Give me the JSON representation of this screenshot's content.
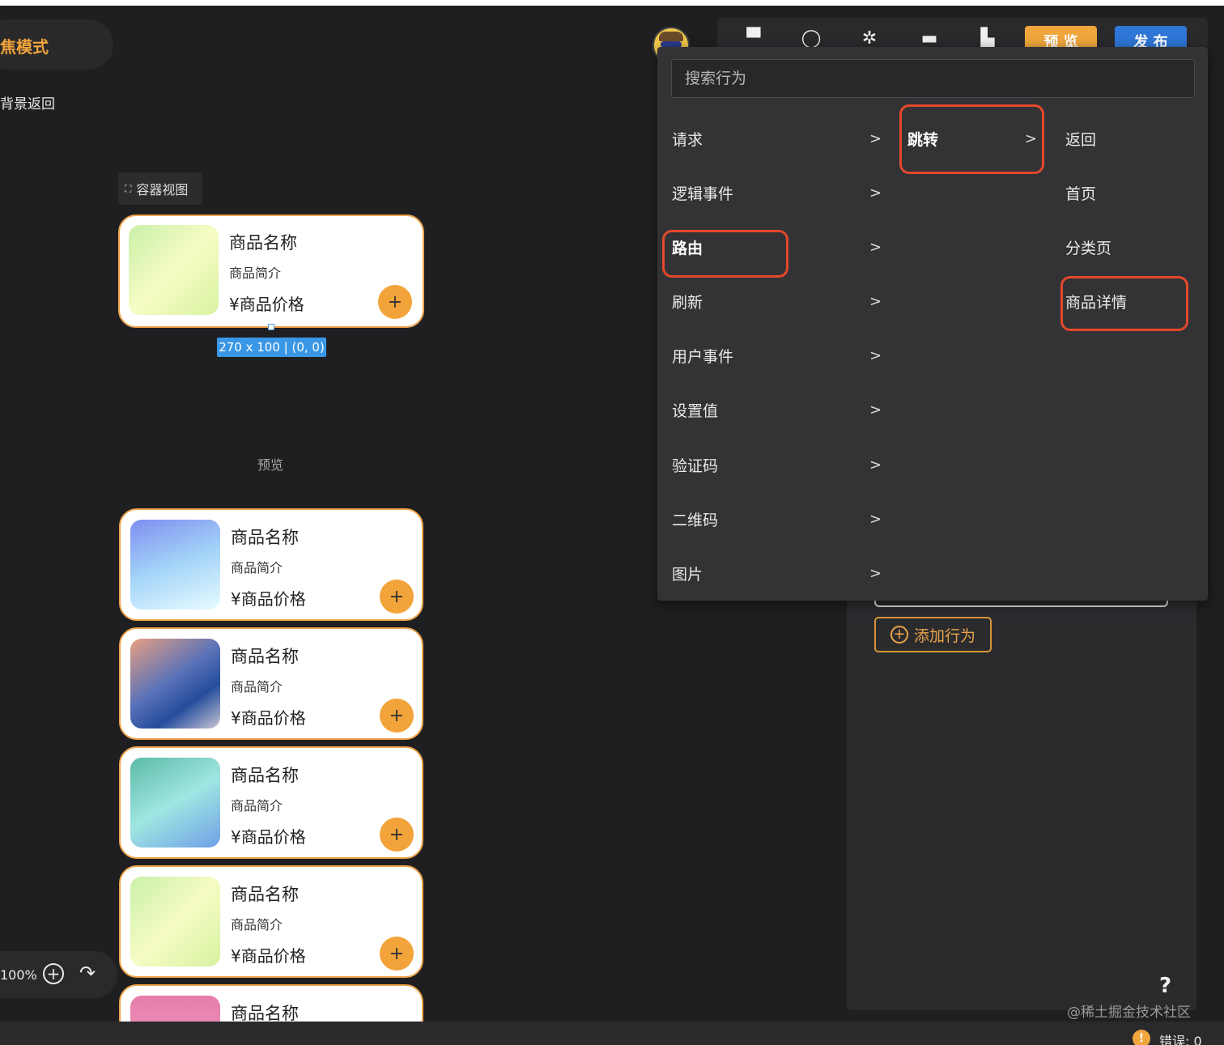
{
  "canvas": {
    "focus_mode": "焦模式",
    "bg_back": "背景返回",
    "container_view": "容器视图",
    "size_badge": "270 x 100 | (0, 0)",
    "preview_label": "预览",
    "zoom": "100%"
  },
  "product_card": {
    "name": "商品名称",
    "desc": "商品简介",
    "price": "¥商品价格",
    "add": "+"
  },
  "toolbar": {
    "icons": [
      "save-icon",
      "search-icon",
      "bug-icon",
      "database-icon",
      "export-icon"
    ],
    "preview": "预 览",
    "publish": "发 布"
  },
  "menu": {
    "search_placeholder": "搜索行为",
    "items": [
      {
        "label": "请求"
      },
      {
        "label": "逻辑事件"
      },
      {
        "label": "路由"
      },
      {
        "label": "刷新"
      },
      {
        "label": "用户事件"
      },
      {
        "label": "设置值"
      },
      {
        "label": "验证码"
      },
      {
        "label": "二维码"
      },
      {
        "label": "图片"
      }
    ],
    "sub1": [
      {
        "label": "跳转"
      }
    ],
    "sub2": [
      {
        "label": "返回"
      },
      {
        "label": "首页"
      },
      {
        "label": "分类页"
      },
      {
        "label": "商品详情"
      }
    ],
    "chevron": ">"
  },
  "panel": {
    "add_behavior": "添加行为",
    "help": "?"
  },
  "watermark": "@稀土掘金技术社区",
  "status": {
    "errors": "错误: 0"
  },
  "colors": {
    "accent": "#f2a33a",
    "publish": "#2f76d6",
    "highlight": "#e5482a"
  }
}
